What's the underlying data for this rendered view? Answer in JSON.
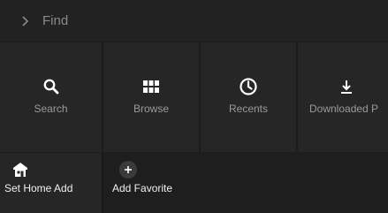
{
  "header": {
    "title": "Find",
    "chevron_icon": "chevron-right-icon"
  },
  "categories": [
    {
      "label": "Search",
      "icon": "search-icon"
    },
    {
      "label": "Browse",
      "icon": "grid-icon"
    },
    {
      "label": "Recents",
      "icon": "clock-icon"
    },
    {
      "label": "Downloaded P",
      "icon": "download-icon"
    }
  ],
  "favorites": [
    {
      "label": "Set Home Add",
      "icon": "home-icon"
    },
    {
      "label": "Add Favorite",
      "icon": "plus-icon"
    }
  ],
  "colors": {
    "background": "#1c1c1c",
    "tile": "#262626",
    "header": "#222222",
    "icon": "#ffffff",
    "label_muted": "#9a9a9a"
  }
}
